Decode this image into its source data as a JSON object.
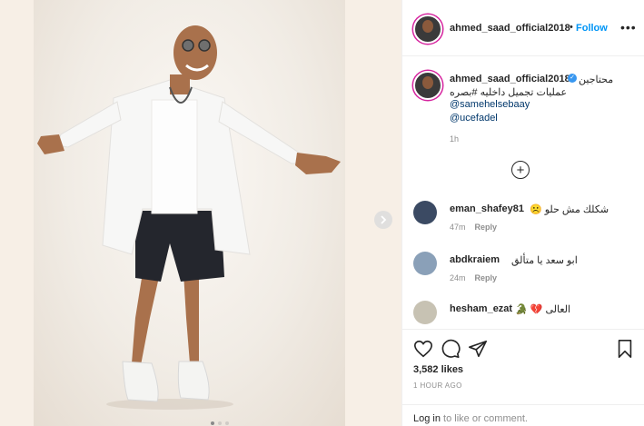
{
  "post": {
    "username": "ahmed_saad_official2018",
    "separator": "•",
    "follow_label": "Follow",
    "more_label": "•••",
    "caption_line1": "محتاجين",
    "caption_line2": "عمليات تجميل داخليه #بصره",
    "mentions": [
      "@samehelsebaay",
      "@ucefadel"
    ],
    "caption_time": "1h",
    "verified_glyph": "✓",
    "load_more_glyph": "+"
  },
  "comments": [
    {
      "username": "eman_shafey81",
      "text": "شكلك مش حلو ☹️",
      "time": "47m",
      "reply": "Reply"
    },
    {
      "username": "abdkraiem",
      "text": "ابو سعد يا متألق",
      "time": "24m",
      "reply": "Reply"
    },
    {
      "username": "hesham_ezat",
      "text": "العالى 💔 🐊",
      "time": "",
      "reply": ""
    }
  ],
  "actions": {
    "likes": "3,582 likes",
    "posted_ago": "1 HOUR AGO",
    "login_link": "Log in",
    "login_rest": " to like or comment."
  },
  "carousel": {
    "total_dots": 3,
    "active_index": 0
  },
  "icons": {
    "like": "heart-icon",
    "comment": "comment-icon",
    "share": "share-icon",
    "save": "bookmark-icon",
    "next": "chevron-right-icon"
  },
  "colors": {
    "follow": "#0095f6",
    "verified": "#3897f0",
    "mention": "#00376b",
    "muted": "#8e8e8e"
  }
}
